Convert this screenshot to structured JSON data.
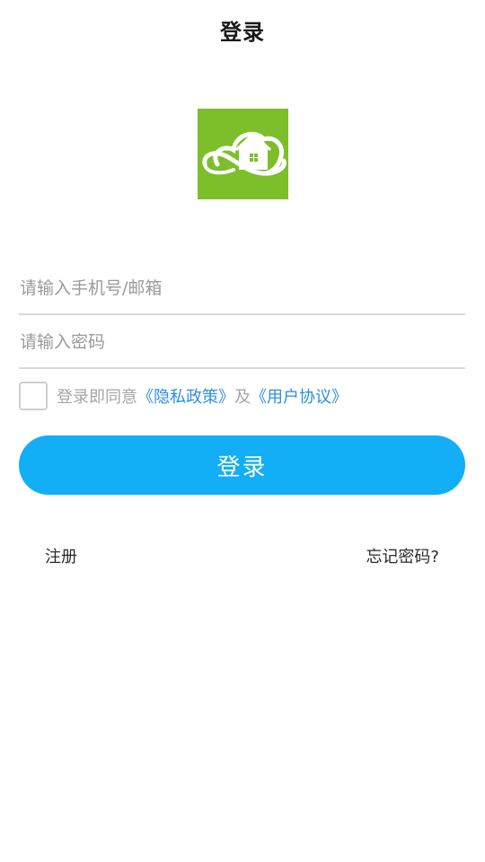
{
  "header": {
    "title": "登录"
  },
  "logo": {
    "icon": "house-cloud-logo",
    "background_color": "#7cbf2b"
  },
  "form": {
    "phone_placeholder": "请输入手机号/邮箱",
    "phone_value": "",
    "password_placeholder": "请输入密码",
    "password_value": "",
    "agree_checked": false,
    "agree_prefix": "登录即同意",
    "privacy_link": "《隐私政策》",
    "conjunction": "及",
    "agreement_link": "《用户协议》",
    "submit_label": "登录"
  },
  "footer": {
    "register_label": "注册",
    "forgot_label": "忘记密码?"
  },
  "colors": {
    "primary_button": "#12aef6",
    "link": "#2b8fe0",
    "logo_green": "#7cbf2b"
  }
}
